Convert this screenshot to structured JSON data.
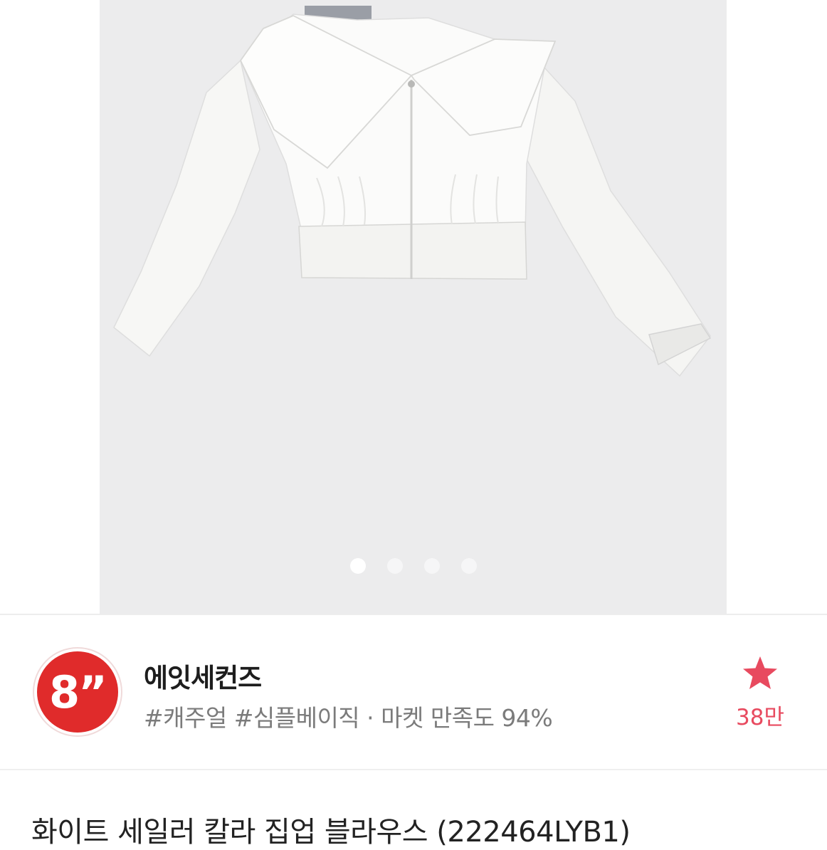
{
  "gallery": {
    "image_alt": "white sailor collar zip-up cropped blouse",
    "background_color": "#ececed",
    "dots_total": 4,
    "active_dot_index": 0
  },
  "shop": {
    "logo_text": "8”",
    "logo_color": "#e02b2b",
    "name": "에잇세컨즈",
    "tags": "#캐주얼 #심플베이직 · 마켓 만족도 94%",
    "favorite_icon": "star-icon",
    "favorite_count": "38만",
    "favorite_color": "#e84a5f"
  },
  "product": {
    "title": "화이트 세일러 칼라 집업 블라우스 (222464LYB1)"
  }
}
